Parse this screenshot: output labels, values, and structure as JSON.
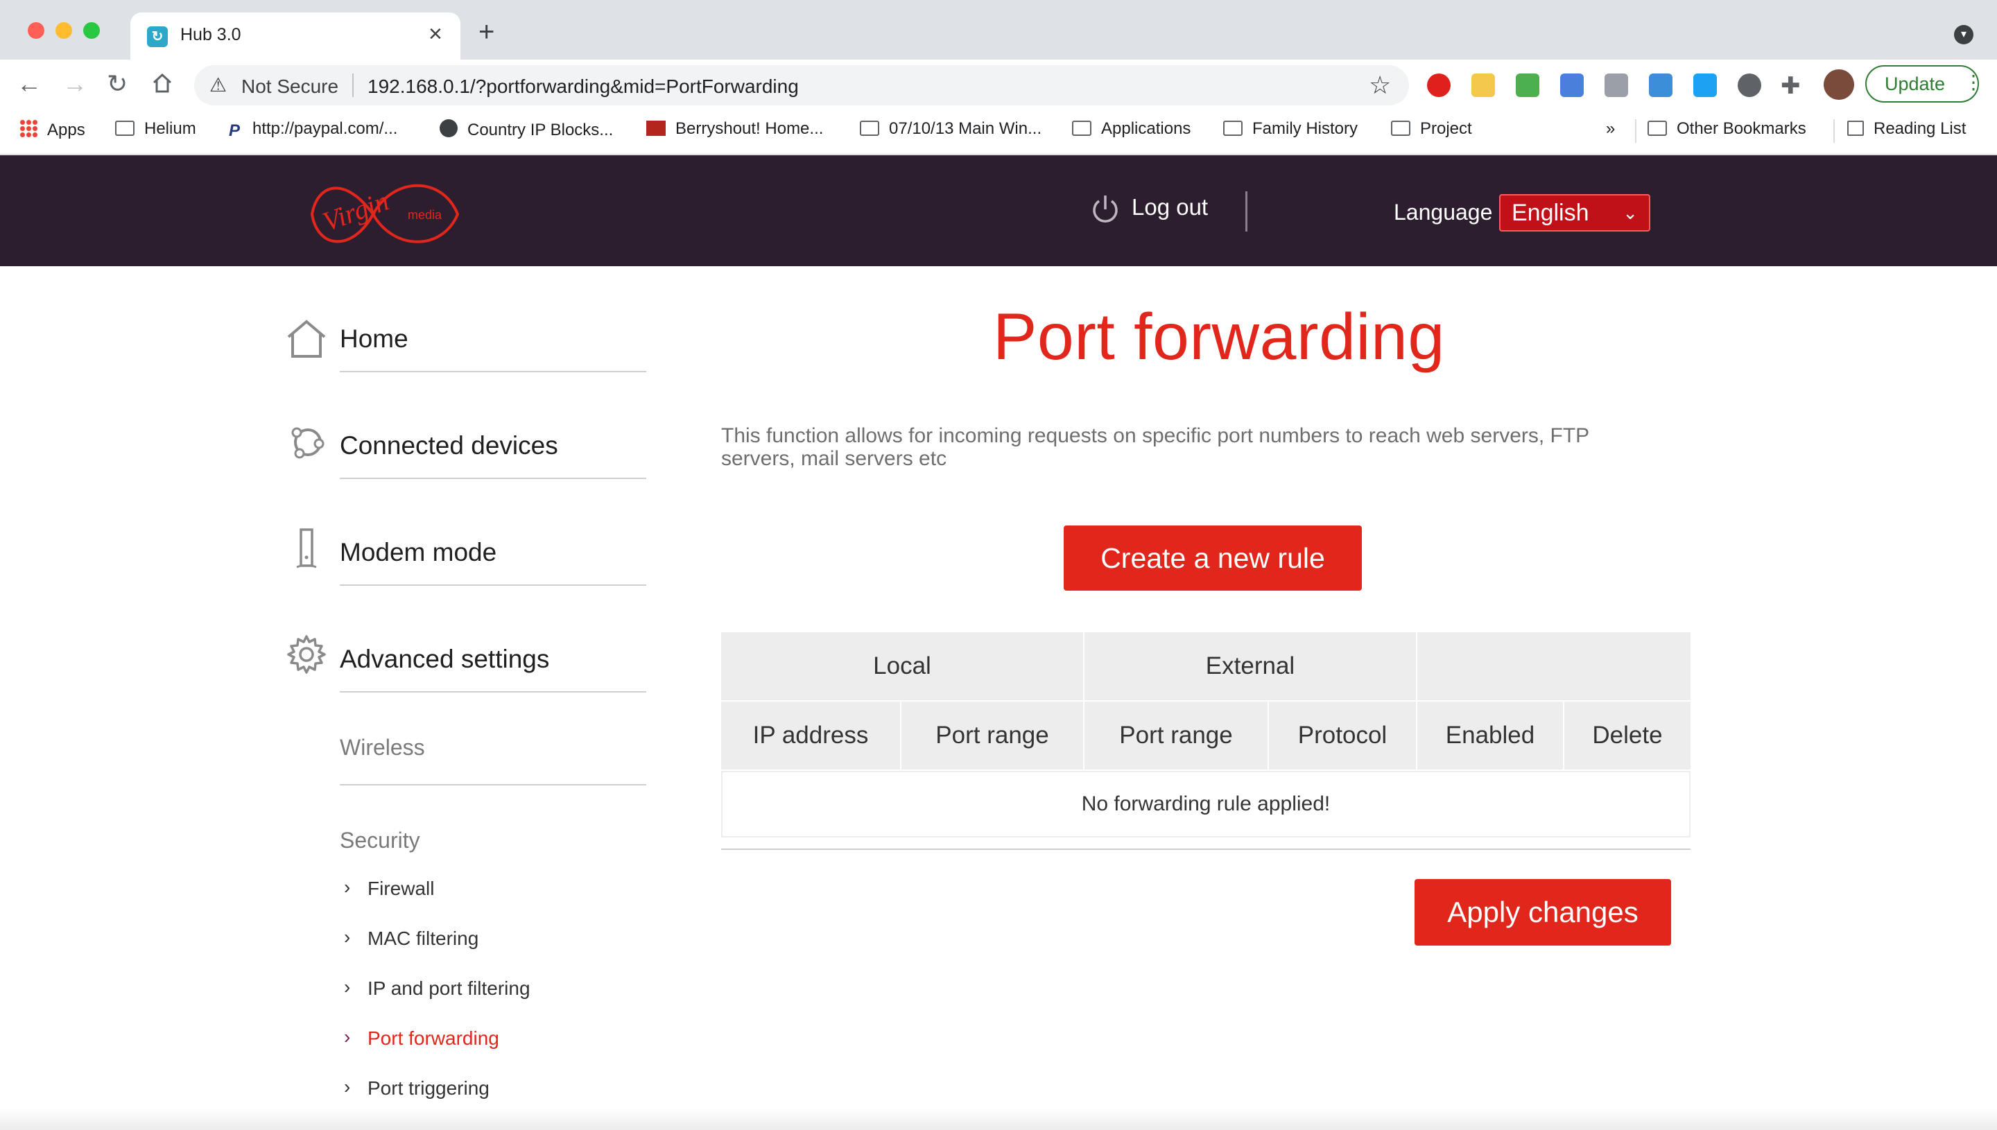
{
  "browser": {
    "tab_title": "Hub 3.0",
    "not_secure": "Not Secure",
    "url": "192.168.0.1/?portforwarding&mid=PortForwarding",
    "update_label": "Update",
    "bookmarks": [
      {
        "label": "Apps",
        "icon": "apps-grid-icon"
      },
      {
        "label": "Helium",
        "icon": "folder-icon"
      },
      {
        "label": "http://paypal.com/...",
        "icon": "paypal-icon"
      },
      {
        "label": "Country IP Blocks...",
        "icon": "globe-icon"
      },
      {
        "label": "Berryshout! Home...",
        "icon": "berryshout-icon"
      },
      {
        "label": "07/10/13 Main Win...",
        "icon": "folder-icon"
      },
      {
        "label": "Applications",
        "icon": "folder-icon"
      },
      {
        "label": "Family History",
        "icon": "folder-icon"
      },
      {
        "label": "Project",
        "icon": "folder-icon"
      }
    ],
    "overflow": "»",
    "other_bookmarks": "Other Bookmarks",
    "reading_list": "Reading List"
  },
  "header": {
    "brand": "Virgin media",
    "logout": "Log out",
    "language_label": "Language",
    "language_value": "English"
  },
  "sidebar": {
    "main": [
      {
        "label": "Home",
        "icon": "home-icon"
      },
      {
        "label": "Connected devices",
        "icon": "connected-devices-icon"
      },
      {
        "label": "Modem mode",
        "icon": "modem-icon"
      },
      {
        "label": "Advanced settings",
        "icon": "gear-icon"
      }
    ],
    "sub": [
      "Wireless",
      "Security"
    ],
    "security_items": [
      "Firewall",
      "MAC filtering",
      "IP and port filtering",
      "Port forwarding",
      "Port triggering"
    ],
    "active": "Port forwarding"
  },
  "main": {
    "title": "Port forwarding",
    "description": "This function allows for incoming requests on specific port numbers to reach web servers, FTP servers, mail servers etc",
    "create_button": "Create a new rule",
    "table": {
      "groups": [
        "Local",
        "External",
        ""
      ],
      "columns": [
        "IP address",
        "Port range",
        "Port range",
        "Protocol",
        "Enabled",
        "Delete"
      ],
      "empty": "No forwarding rule applied!"
    },
    "apply_button": "Apply changes"
  },
  "colors": {
    "accent": "#e1261c",
    "header_bg": "#2d1e2f",
    "active_chevron": "#7a1f55"
  }
}
